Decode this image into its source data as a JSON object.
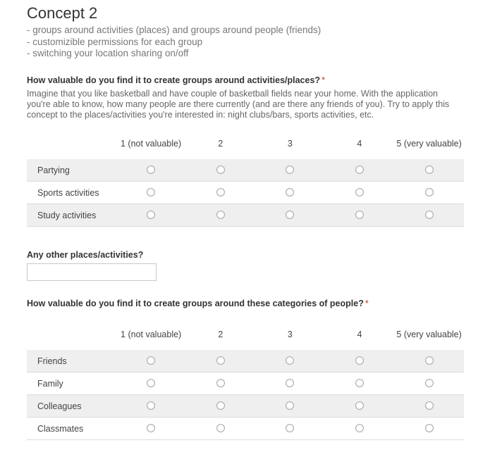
{
  "concept": {
    "title": "Concept 2",
    "points": [
      "- groups around activities (places) and groups around people (friends)",
      "- customizible permissions for each group",
      "- switching your location sharing on/off"
    ]
  },
  "question1": {
    "title": "How valuable do you find it to create groups around activities/places?",
    "required_mark": "*",
    "help": "Imagine that you like basketball and have couple of basketball fields near your home. With the application you're able to know, how many people are there currently (and are there any friends of you). Try to apply this concept to the places/activities you're interested in: night clubs/bars, sports activities, etc.",
    "columns": [
      "1 (not valuable)",
      "2",
      "3",
      "4",
      "5 (very valuable)"
    ],
    "rows": [
      "Partying",
      "Sports activities",
      "Study activities"
    ]
  },
  "question2": {
    "title": "Any other places/activities?",
    "value": ""
  },
  "question3": {
    "title": "How valuable do you find it to create groups around these categories of people?",
    "required_mark": "*",
    "columns": [
      "1 (not valuable)",
      "2",
      "3",
      "4",
      "5 (very valuable)"
    ],
    "rows": [
      "Friends",
      "Family",
      "Colleagues",
      "Classmates"
    ]
  }
}
